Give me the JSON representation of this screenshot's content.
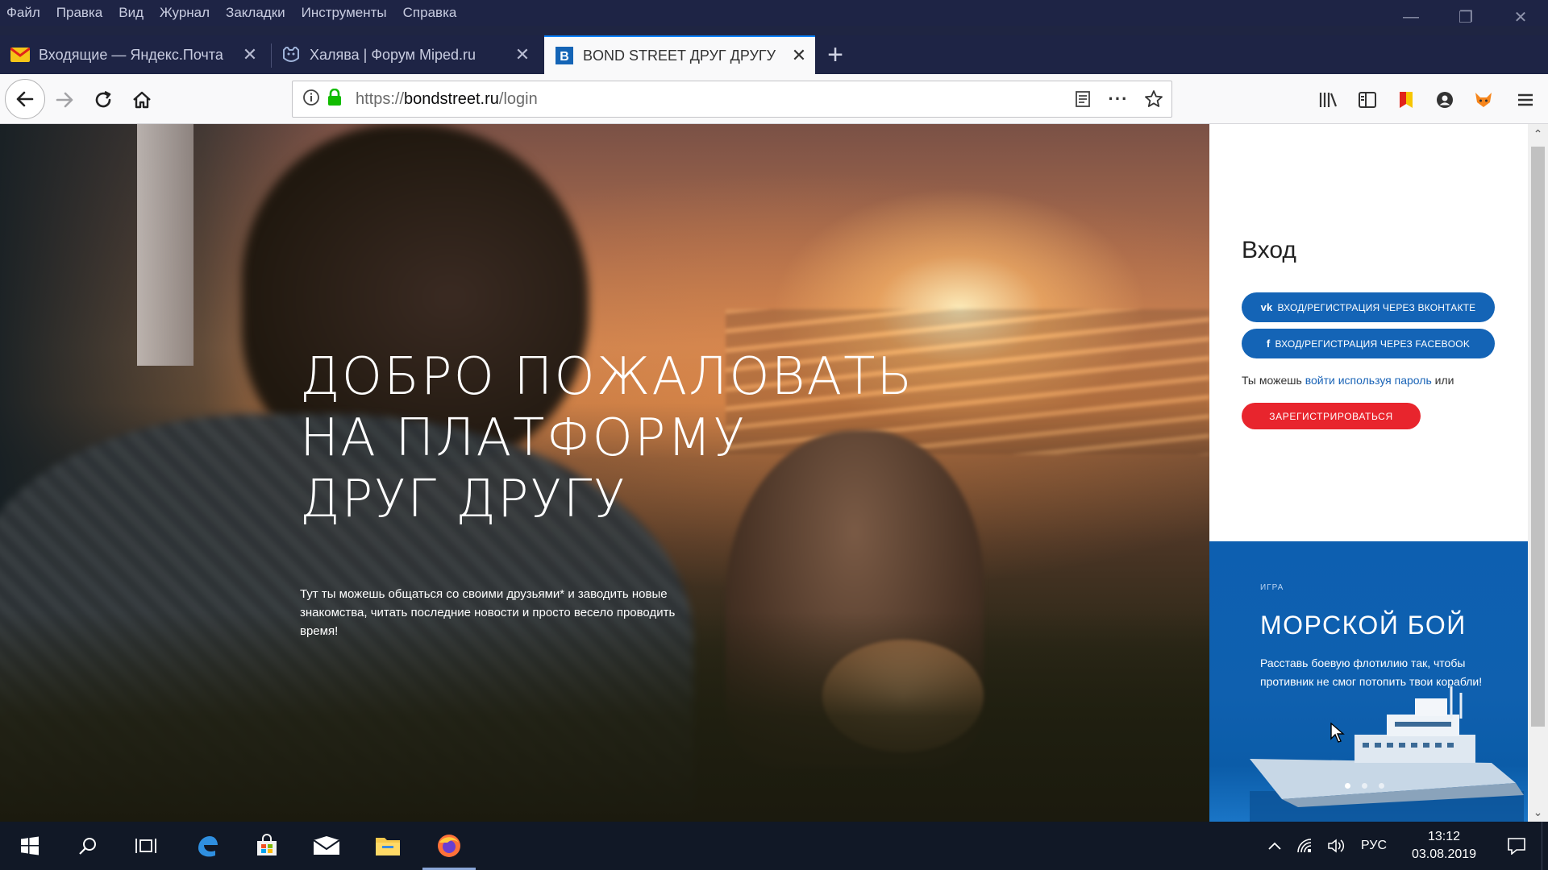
{
  "menu": [
    "Файл",
    "Правка",
    "Вид",
    "Журнал",
    "Закладки",
    "Инструменты",
    "Справка"
  ],
  "tabs": [
    {
      "title": "Входящие — Яндекс.Почта",
      "favicon": "mail-icon"
    },
    {
      "title": "Халява | Форум Miped.ru",
      "favicon": "forum-icon"
    },
    {
      "title": "BOND STREET ДРУГ ДРУГУ",
      "favicon": "bondstreet-icon"
    }
  ],
  "url": {
    "scheme": "https://",
    "host": "bondstreet.ru",
    "path": "/login"
  },
  "hero": {
    "title_lines": [
      "ДОБРО ПОЖАЛОВАТЬ",
      "НА ПЛАТФОРМУ",
      "ДРУГ ДРУГУ"
    ],
    "text": "Тут ты можешь общаться со своими друзьями* и заводить новые знакомства, читать последние новости и просто весело проводить время!"
  },
  "login": {
    "title": "Вход",
    "vk_label": "ВХОД/РЕГИСТРАЦИЯ ЧЕРЕЗ ВКОНТАКТЕ",
    "fb_label": "ВХОД/РЕГИСТРАЦИЯ ЧЕРЕЗ FACEBOOK",
    "hint_before": "Ты можешь ",
    "hint_link": "войти используя пароль",
    "hint_after": " или",
    "register_label": "ЗАРЕГИСТРИРОВАТЬСЯ"
  },
  "promo": {
    "eyebrow": "ИГРА",
    "title": "МОРСКОЙ БОЙ",
    "text": "Расставь боевую флотилию так, чтобы противник не смог потопить твои корабли!",
    "slides": 3,
    "active_slide": 1
  },
  "taskbar": {
    "language": "РУС",
    "time": "13:12",
    "date": "03.08.2019"
  },
  "colors": {
    "accent_blue": "#1464b6",
    "register_red": "#e8252d",
    "promo_blue": "#0d5fb0",
    "browser_dark": "#1e2445"
  }
}
